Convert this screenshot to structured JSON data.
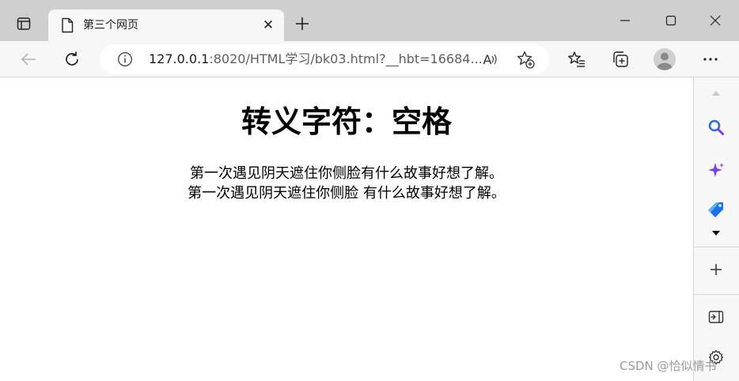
{
  "browser": {
    "tab": {
      "title": "第三个网页",
      "close_glyph": "✕"
    },
    "new_tab_glyph": "+",
    "address": {
      "host": "127.0.0.1",
      "rest": ":8020/HTML学习/bk03.html?__hbt=16684..."
    },
    "read_aloud_label": "A",
    "icons": {
      "tab_actions": "tab-actions-icon",
      "back": "back-arrow-icon",
      "refresh": "refresh-icon",
      "info": "info-icon",
      "add_favorite": "star-plus-icon",
      "favorites": "favorites-list-icon",
      "collections": "collections-icon",
      "profile": "profile-avatar-icon",
      "more": "more-dots-icon"
    },
    "colors": {
      "tabstrip": "#cfcfcf",
      "toolbar": "#f7f7f7",
      "search_accent": "#2f6fd6",
      "copilot_accent": "#7a3ff2",
      "shopping_accent": "#1a73e8"
    }
  },
  "page": {
    "heading": "转义字符：空格",
    "lines": [
      "第一次遇见阴天遮住你侧脸有什么故事好想了解。",
      "第一次遇见阴天遮住你侧脸 有什么故事好想了解。"
    ]
  },
  "sidebar": {
    "icons": [
      "scroll-up-icon",
      "search-icon",
      "copilot-icon",
      "shopping-tag-icon",
      "expand-chevron-icon",
      "add-icon",
      "split-screen-icon",
      "settings-icon"
    ]
  },
  "watermark": "CSDN @恰似情书"
}
